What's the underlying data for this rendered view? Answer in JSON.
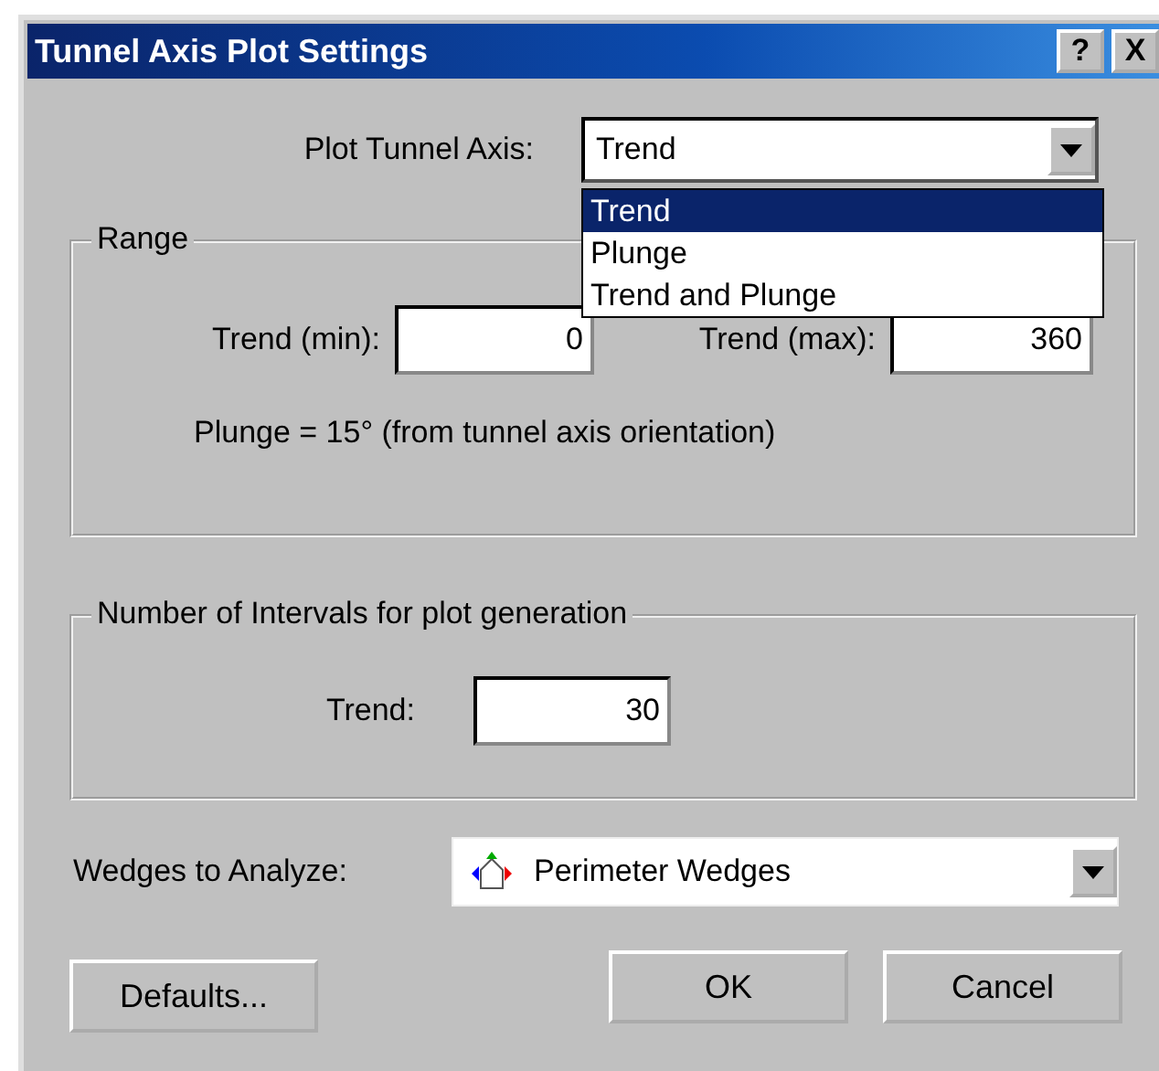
{
  "window": {
    "title": "Tunnel Axis Plot Settings",
    "title_buttons": [
      "?",
      "X"
    ]
  },
  "plot_axis": {
    "label": "Plot Tunnel Axis:",
    "value": "Trend",
    "expanded": true,
    "options": [
      {
        "label": "Trend",
        "selected": true
      },
      {
        "label": "Plunge",
        "selected": false
      },
      {
        "label": "Trend and Plunge",
        "selected": false
      }
    ]
  },
  "range": {
    "title": "Range",
    "trend_min": {
      "label": "Trend (min):",
      "value": "0"
    },
    "trend_max": {
      "label": "Trend (max):",
      "value": "360"
    },
    "note": "Plunge = 15° (from tunnel axis orientation)"
  },
  "intervals": {
    "title": "Number of Intervals for plot generation",
    "trend": {
      "label": "Trend:",
      "value": "30"
    }
  },
  "wedges": {
    "label": "Wedges to Analyze:",
    "value": "Perimeter Wedges"
  },
  "buttons": {
    "defaults": "Defaults...",
    "ok": "OK",
    "cancel": "Cancel"
  }
}
